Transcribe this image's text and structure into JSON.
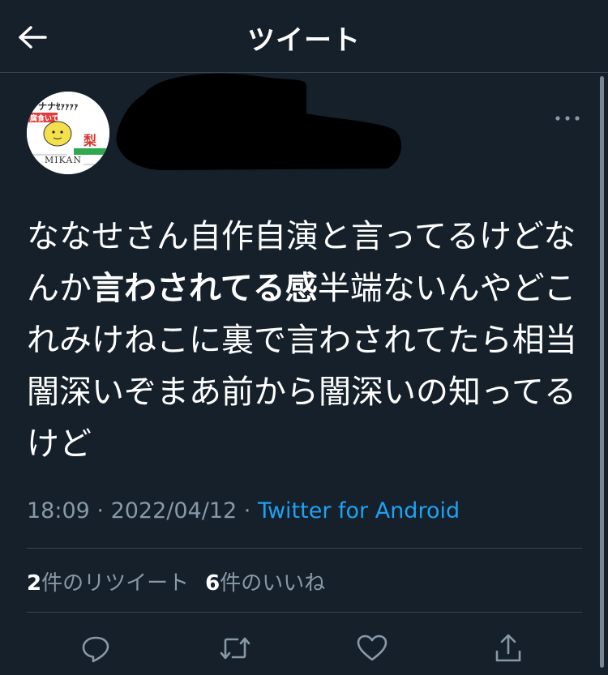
{
  "header": {
    "title": "ツイート",
    "back_icon": "arrow-left-icon"
  },
  "tweet": {
    "avatar": {
      "lines": [
        "ナナｾｧｧｧｧ",
        "腐食いてぇ",
        "梨",
        "MIKAN"
      ]
    },
    "text_parts": {
      "p1": "ななせさん自作自演と言ってるけどなんか",
      "bold": "言わされてる感",
      "p2": "半端ないんやどこれみけねこに裏で言わされてたら相当闇深いぞまあ前から闇深いの知ってるけど"
    },
    "time": "18:09",
    "date": "2022/04/12",
    "separator": " · ",
    "source": "Twitter for Android",
    "retweets": {
      "count": "2",
      "label": "件のリツイート"
    },
    "likes": {
      "count": "6",
      "label": "件のいいね"
    }
  },
  "actions": {
    "reply_icon": "reply-icon",
    "retweet_icon": "retweet-icon",
    "like_icon": "heart-icon",
    "share_icon": "share-icon"
  },
  "colors": {
    "background": "#15202b",
    "text": "#ffffff",
    "secondary": "#8899a6",
    "link": "#1da1f2",
    "divider": "#38444d"
  }
}
